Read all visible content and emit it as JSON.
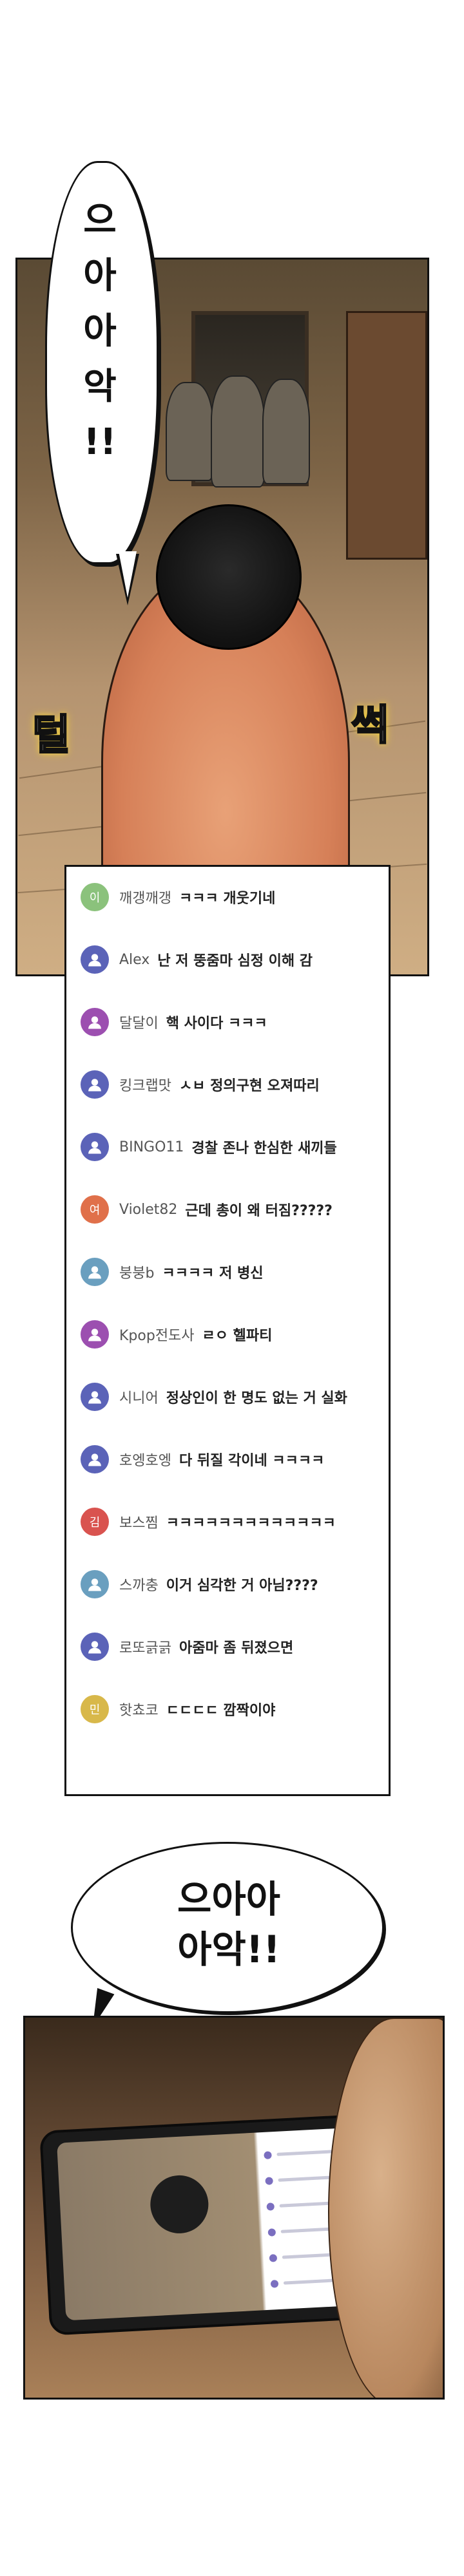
{
  "panel1": {
    "bubble_lines": [
      "으",
      "아",
      "아",
      "악",
      "!!"
    ],
    "sfx_left": "털",
    "sfx_right": "썩"
  },
  "comments": [
    {
      "nick": "깨갱깨갱",
      "msg": "ㅋㅋㅋ 개웃기네",
      "avatar": {
        "type": "letter",
        "letter": "이",
        "color": "#8bc27c"
      }
    },
    {
      "nick": "Alex",
      "msg": "난 저 뚱줌마 심정 이해 감",
      "avatar": {
        "type": "person",
        "color": "#5b63b8"
      }
    },
    {
      "nick": "달달이",
      "msg": "핵 사이다 ㅋㅋㅋ",
      "avatar": {
        "type": "person",
        "color": "#9c4fb0"
      }
    },
    {
      "nick": "킹크랩맛",
      "msg": "ㅅㅂ 정의구현 오져따리",
      "avatar": {
        "type": "person",
        "color": "#5b63b8"
      }
    },
    {
      "nick": "BINGO11",
      "msg": "경찰 존나 한심한 새끼들",
      "avatar": {
        "type": "person",
        "color": "#5b63b8"
      }
    },
    {
      "nick": "Violet82",
      "msg": "근데 총이 왜 터짐?????",
      "avatar": {
        "type": "letter",
        "letter": "여",
        "color": "#e0704a"
      }
    },
    {
      "nick": "붕붕b",
      "msg": "ㅋㅋㅋㅋ 저 병신",
      "avatar": {
        "type": "person",
        "color": "#6a9fbf"
      }
    },
    {
      "nick": "Kpop전도사",
      "msg": "ㄹㅇ 헬파티",
      "avatar": {
        "type": "person",
        "color": "#9c4fb0"
      }
    },
    {
      "nick": "시니어",
      "msg": "정상인이 한 명도 없는 거 실화",
      "avatar": {
        "type": "person",
        "color": "#5b63b8"
      }
    },
    {
      "nick": "호엥호엥",
      "msg": "다 뒤질 각이네 ㅋㅋㅋㅋ",
      "avatar": {
        "type": "person",
        "color": "#5b63b8"
      }
    },
    {
      "nick": "보스찜",
      "msg": "ㅋㅋㅋㅋㅋㅋㅋㅋㅋㅋㅋㅋㅋ",
      "avatar": {
        "type": "letter",
        "letter": "김",
        "color": "#d9534f"
      }
    },
    {
      "nick": "스까충",
      "msg": "이거 심각한 거 아님????",
      "avatar": {
        "type": "person",
        "color": "#6a9fbf"
      }
    },
    {
      "nick": "로또긁긁",
      "msg": "아줌마 좀 뒤졌으면",
      "avatar": {
        "type": "person",
        "color": "#5b63b8"
      }
    },
    {
      "nick": "핫쵸코",
      "msg": "ㄷㄷㄷㄷ 깜짝이야",
      "avatar": {
        "type": "letter",
        "letter": "민",
        "color": "#d8b84a"
      }
    }
  ],
  "bubble2": {
    "line1": "으아아",
    "line2": "아악!!"
  }
}
